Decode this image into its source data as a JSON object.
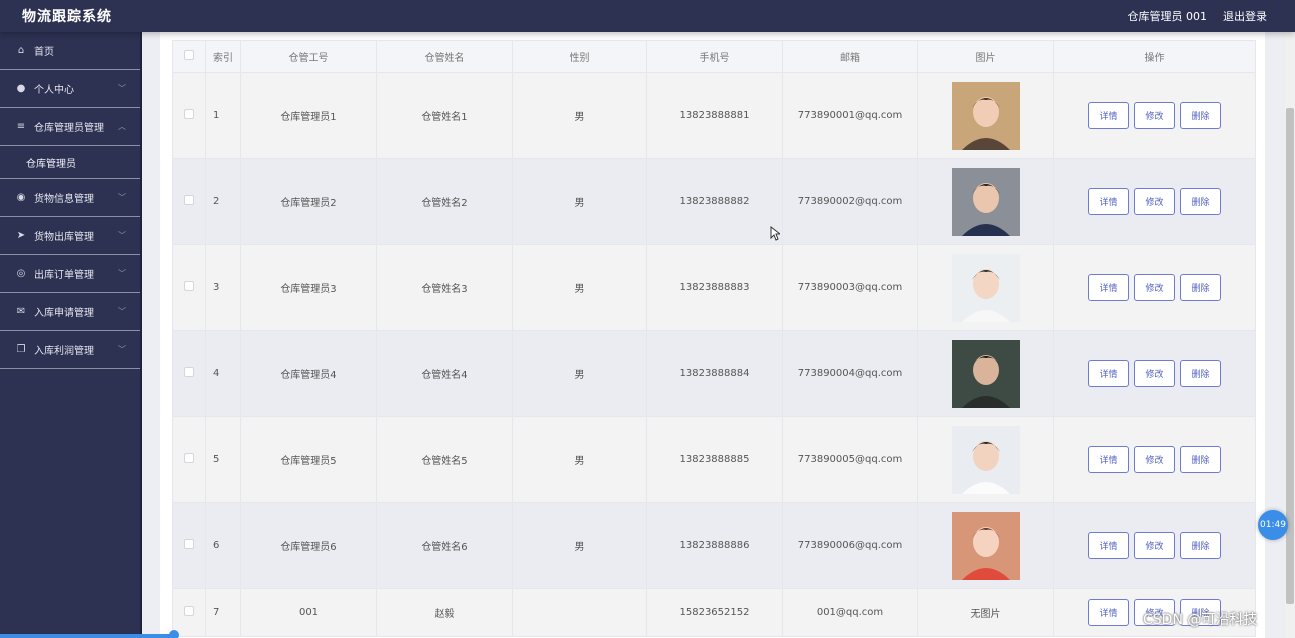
{
  "header": {
    "app_title": "物流跟踪系统",
    "user_label": "仓库管理员 001",
    "logout_label": "退出登录"
  },
  "sidebar": {
    "items": [
      {
        "label": "首页",
        "icon": "home-icon",
        "has_children": false
      },
      {
        "label": "个人中心",
        "icon": "user-icon",
        "has_children": true
      },
      {
        "label": "仓库管理员管理",
        "icon": "sliders-icon",
        "has_children": true,
        "expanded": true,
        "children": [
          {
            "label": "仓库管理员"
          }
        ]
      },
      {
        "label": "货物信息管理",
        "icon": "location-icon",
        "has_children": true
      },
      {
        "label": "货物出库管理",
        "icon": "send-icon",
        "has_children": true
      },
      {
        "label": "出库订单管理",
        "icon": "globe-icon",
        "has_children": true
      },
      {
        "label": "入库申请管理",
        "icon": "mail-icon",
        "has_children": true
      },
      {
        "label": "入库利润管理",
        "icon": "copy-icon",
        "has_children": true
      }
    ]
  },
  "table": {
    "headers": [
      "索引",
      "仓管工号",
      "仓管姓名",
      "性别",
      "手机号",
      "邮箱",
      "图片",
      "操作"
    ],
    "actions": {
      "detail": "详情",
      "edit": "修改",
      "delete": "删除"
    },
    "rows": [
      {
        "index": "1",
        "emp_no": "仓库管理员1",
        "name": "仓管姓名1",
        "gender": "男",
        "phone": "13823888881",
        "email": "773890001@qq.com",
        "image": "portrait-photo",
        "image_text": ""
      },
      {
        "index": "2",
        "emp_no": "仓库管理员2",
        "name": "仓管姓名2",
        "gender": "男",
        "phone": "13823888882",
        "email": "773890002@qq.com",
        "image": "portrait-photo",
        "image_text": ""
      },
      {
        "index": "3",
        "emp_no": "仓库管理员3",
        "name": "仓管姓名3",
        "gender": "男",
        "phone": "13823888883",
        "email": "773890003@qq.com",
        "image": "portrait-photo",
        "image_text": ""
      },
      {
        "index": "4",
        "emp_no": "仓库管理员4",
        "name": "仓管姓名4",
        "gender": "男",
        "phone": "13823888884",
        "email": "773890004@qq.com",
        "image": "portrait-photo",
        "image_text": ""
      },
      {
        "index": "5",
        "emp_no": "仓库管理员5",
        "name": "仓管姓名5",
        "gender": "男",
        "phone": "13823888885",
        "email": "773890005@qq.com",
        "image": "portrait-photo",
        "image_text": ""
      },
      {
        "index": "6",
        "emp_no": "仓库管理员6",
        "name": "仓管姓名6",
        "gender": "男",
        "phone": "13823888886",
        "email": "773890006@qq.com",
        "image": "portrait-photo",
        "image_text": ""
      },
      {
        "index": "7",
        "emp_no": "001",
        "name": "赵毅",
        "gender": "",
        "phone": "15823652152",
        "email": "001@qq.com",
        "image": "",
        "image_text": "无图片"
      }
    ]
  },
  "overlay": {
    "timer": "01:49",
    "watermark": "CSDN @可沿科技"
  },
  "colors": {
    "sidebar_bg": "#2d3152",
    "accent_button": "#5462c2",
    "timer_blue": "#3b8ee8"
  }
}
